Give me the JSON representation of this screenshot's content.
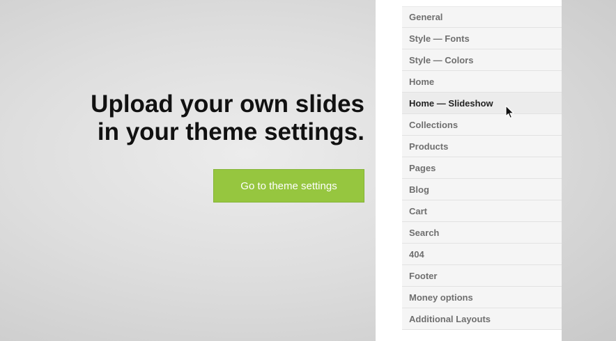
{
  "hero": {
    "line1": "Upload your own slides",
    "line2": "in your theme settings.",
    "button_label": "Go to theme settings"
  },
  "settings_menu": {
    "active_index": 4,
    "items": [
      {
        "label": "General"
      },
      {
        "label": "Style — Fonts"
      },
      {
        "label": "Style — Colors"
      },
      {
        "label": "Home"
      },
      {
        "label": "Home — Slideshow"
      },
      {
        "label": "Collections"
      },
      {
        "label": "Products"
      },
      {
        "label": "Pages"
      },
      {
        "label": "Blog"
      },
      {
        "label": "Cart"
      },
      {
        "label": "Search"
      },
      {
        "label": "404"
      },
      {
        "label": "Footer"
      },
      {
        "label": "Money options"
      },
      {
        "label": "Additional Layouts"
      }
    ]
  },
  "icons": {
    "cursor": "mouse-pointer-icon"
  },
  "colors": {
    "button_bg": "#96c63f",
    "button_text": "#ffffff",
    "menu_bg": "#f5f5f5",
    "menu_active_bg": "#ececec",
    "menu_text": "#6f6f6f",
    "menu_active_text": "#222222"
  }
}
